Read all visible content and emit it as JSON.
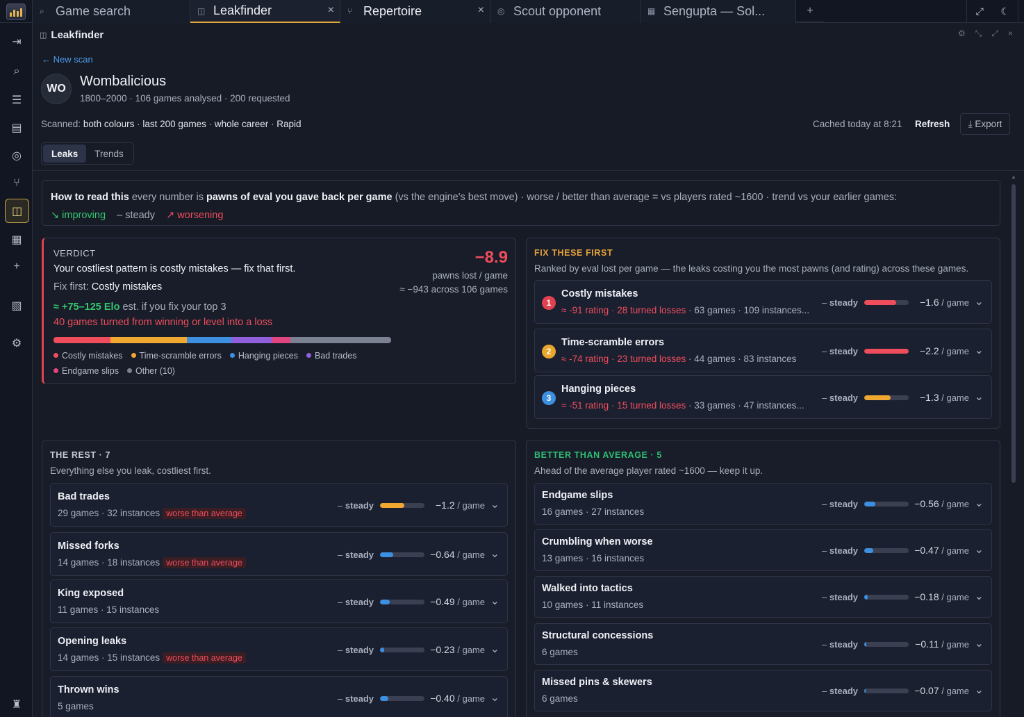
{
  "tabs": [
    {
      "icon": "search-icon",
      "label": "Game search",
      "glyph": "⌕"
    },
    {
      "icon": "leakfinder-icon",
      "label": "Leakfinder",
      "glyph": "◫",
      "active": true
    },
    {
      "icon": "branch-icon",
      "label": "Repertoire",
      "glyph": "⑂"
    },
    {
      "icon": "target-icon",
      "label": "Scout opponent",
      "glyph": "◎"
    },
    {
      "icon": "grid-icon",
      "label": "Sengupta — Sol...",
      "glyph": "▦"
    }
  ],
  "panel": {
    "title": "Leakfinder"
  },
  "back_label": "New scan",
  "player": {
    "initials": "WO",
    "name": "Wombalicious",
    "meta": "1800–2000 · 106 games analysed · 200 requested"
  },
  "scan": {
    "label": "Scanned:",
    "colours": "both colours",
    "sep1": " · ",
    "games": "last 200 games",
    "sep2": " · ",
    "career": "whole career",
    "sep3": " · ",
    "speed": "Rapid"
  },
  "cached": "Cached today at 8:21",
  "refresh_label": "Refresh",
  "export_label": "Export",
  "view_tabs": {
    "leaks": "Leaks",
    "trends": "Trends"
  },
  "howto": {
    "title": "How to read this",
    "t1": " every number is ",
    "t2": "pawns of eval you gave back per game",
    "t3": " (vs the engine's best move)   ·   worse / better than average = vs players rated ~1600   · trend vs your earlier games:",
    "improving": "↘ improving",
    "steady": "– steady",
    "worsening": "↗ worsening"
  },
  "verdict": {
    "label": "VERDICT",
    "headline": "Your costliest pattern is costly mistakes — fix that first.",
    "fix_prefix": "Fix first: ",
    "fix_item": "Costly mistakes",
    "elo_prefix": "≈ ",
    "elo_value": "+75–125 Elo",
    "elo_suffix": " est. if you fix your top 3",
    "turned": "40 games turned from winning or level into a loss",
    "big_value": "−8.9",
    "big_unit": "pawns lost / game",
    "big_total": "≈ −943 across 106 games",
    "segments": [
      {
        "name": "Costly mistakes",
        "color": "#ef4d5c",
        "share": 0.168
      },
      {
        "name": "Time-scramble errors",
        "color": "#f0a830",
        "share": 0.228
      },
      {
        "name": "Hanging pieces",
        "color": "#3d8fe0",
        "share": 0.13
      },
      {
        "name": "Bad trades",
        "color": "#8f5fdc",
        "share": 0.12
      },
      {
        "name": "Endgame slips",
        "color": "#e0457f",
        "share": 0.056
      },
      {
        "name": "Other (10)",
        "color": "#7b8191",
        "share": 0.298
      }
    ]
  },
  "fix_first": {
    "title": "FIX THESE FIRST",
    "subtitle": "Ranked by eval lost per game — the leaks costing you the most pawns (and rating) across these games.",
    "items": [
      {
        "rank": "1",
        "rank_color": "#e0424f",
        "name": "Costly mistakes",
        "rating": "≈ -91 rating · 28 turned losses",
        "meta": " · 63 games · 109 instances...",
        "trend": "steady",
        "fill": 0.72,
        "fill_color": "#ef4d5c",
        "value": "−1.6",
        "unit": " / game"
      },
      {
        "rank": "2",
        "rank_color": "#e8a62c",
        "name": "Time-scramble errors",
        "rating": "≈ -74 rating · 23 turned losses",
        "meta": " · 44 games · 83 instances",
        "trend": "steady",
        "fill": 1.0,
        "fill_color": "#ef4d5c",
        "value": "−2.2",
        "unit": " / game"
      },
      {
        "rank": "3",
        "rank_color": "#3d8fe0",
        "name": "Hanging pieces",
        "rating": "≈ -51 rating · 15 turned losses",
        "meta": " · 33 games · 47 instances...",
        "trend": "steady",
        "fill": 0.59,
        "fill_color": "#f0a830",
        "value": "−1.3",
        "unit": " / game"
      }
    ]
  },
  "rest": {
    "title": "THE REST · 7",
    "subtitle": "Everything else you leak, costliest first.",
    "items": [
      {
        "name": "Bad trades",
        "meta": "29 games · 32 instances",
        "badge": "worse than average",
        "trend": "steady",
        "fill": 0.55,
        "fill_color": "#f0a830",
        "value": "−1.2",
        "unit": " / game"
      },
      {
        "name": "Missed forks",
        "meta": "14 games · 18 instances",
        "badge": "worse than average",
        "trend": "steady",
        "fill": 0.29,
        "fill_color": "#3d8fe0",
        "value": "−0.64",
        "unit": " / game"
      },
      {
        "name": "King exposed",
        "meta": "11 games · 15 instances",
        "badge": "",
        "trend": "steady",
        "fill": 0.22,
        "fill_color": "#3d8fe0",
        "value": "−0.49",
        "unit": " / game"
      },
      {
        "name": "Opening leaks",
        "meta": "14 games · 15 instances",
        "badge": "worse than average",
        "trend": "steady",
        "fill": 0.1,
        "fill_color": "#3d8fe0",
        "value": "−0.23",
        "unit": " / game"
      },
      {
        "name": "Thrown wins",
        "meta": "5 games",
        "badge": "",
        "trend": "steady",
        "fill": 0.18,
        "fill_color": "#3d8fe0",
        "value": "−0.40",
        "unit": " / game"
      }
    ]
  },
  "better": {
    "title": "BETTER THAN AVERAGE · 5",
    "subtitle": "Ahead of the average player rated ~1600 — keep it up.",
    "items": [
      {
        "name": "Endgame slips",
        "meta": "16 games · 27 instances",
        "trend": "steady",
        "fill": 0.25,
        "fill_color": "#3d8fe0",
        "value": "−0.56",
        "unit": " / game"
      },
      {
        "name": "Crumbling when worse",
        "meta": "13 games · 16 instances",
        "trend": "steady",
        "fill": 0.21,
        "fill_color": "#3d8fe0",
        "value": "−0.47",
        "unit": " / game"
      },
      {
        "name": "Walked into tactics",
        "meta": "10 games · 11 instances",
        "trend": "steady",
        "fill": 0.08,
        "fill_color": "#3d8fe0",
        "value": "−0.18",
        "unit": " / game"
      },
      {
        "name": "Structural concessions",
        "meta": "6 games",
        "trend": "steady",
        "fill": 0.05,
        "fill_color": "#3d8fe0",
        "value": "−0.11",
        "unit": " / game"
      },
      {
        "name": "Missed pins & skewers",
        "meta": "6 games",
        "trend": "steady",
        "fill": 0.03,
        "fill_color": "#3d8fe0",
        "value": "−0.07",
        "unit": " / game"
      }
    ]
  }
}
